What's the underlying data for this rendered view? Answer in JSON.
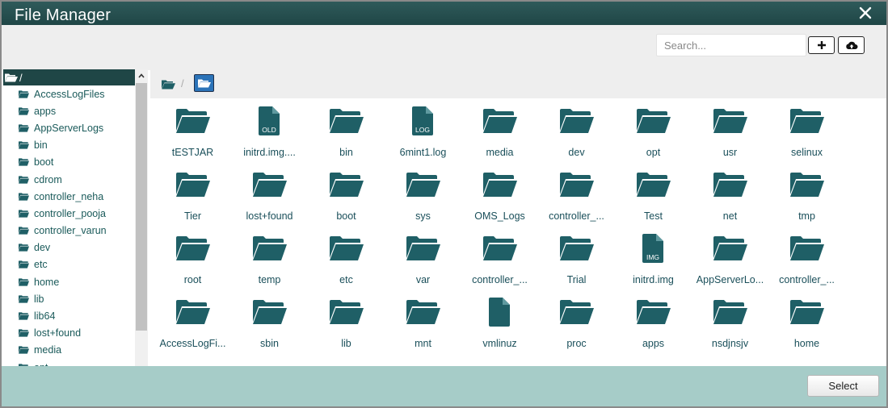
{
  "window": {
    "title": "File Manager",
    "close_icon": "close-icon"
  },
  "toolbar": {
    "search_placeholder": "Search...",
    "search_value": "",
    "add_icon": "plus-icon",
    "upload_icon": "cloud-upload-icon"
  },
  "tree": {
    "root_label": "/",
    "items": [
      "AccessLogFiles",
      "apps",
      "AppServerLogs",
      "bin",
      "boot",
      "cdrom",
      "controller_neha",
      "controller_pooja",
      "controller_varun",
      "dev",
      "etc",
      "home",
      "lib",
      "lib64",
      "lost+found",
      "media",
      "opt"
    ]
  },
  "breadcrumb": {
    "separator": "/",
    "home_icon": "folder-open-icon",
    "current_icon": "folder-open-icon"
  },
  "files": [
    {
      "name": "tESTJAR",
      "type": "folder"
    },
    {
      "name": "initrd.img....",
      "type": "file",
      "badge": "OLD"
    },
    {
      "name": "bin",
      "type": "folder"
    },
    {
      "name": "6mint1.log",
      "type": "file",
      "badge": "LOG"
    },
    {
      "name": "media",
      "type": "folder"
    },
    {
      "name": "dev",
      "type": "folder"
    },
    {
      "name": "opt",
      "type": "folder"
    },
    {
      "name": "usr",
      "type": "folder"
    },
    {
      "name": "selinux",
      "type": "folder"
    },
    {
      "name": "Tier",
      "type": "folder"
    },
    {
      "name": "lost+found",
      "type": "folder"
    },
    {
      "name": "boot",
      "type": "folder"
    },
    {
      "name": "sys",
      "type": "folder"
    },
    {
      "name": "OMS_Logs",
      "type": "folder"
    },
    {
      "name": "controller_...",
      "type": "folder"
    },
    {
      "name": "Test",
      "type": "folder"
    },
    {
      "name": "net",
      "type": "folder"
    },
    {
      "name": "tmp",
      "type": "folder"
    },
    {
      "name": "root",
      "type": "folder"
    },
    {
      "name": "temp",
      "type": "folder"
    },
    {
      "name": "etc",
      "type": "folder"
    },
    {
      "name": "var",
      "type": "folder"
    },
    {
      "name": "controller_...",
      "type": "folder"
    },
    {
      "name": "Trial",
      "type": "folder"
    },
    {
      "name": "initrd.img",
      "type": "file",
      "badge": "IMG"
    },
    {
      "name": "AppServerLo...",
      "type": "folder"
    },
    {
      "name": "controller_...",
      "type": "folder"
    },
    {
      "name": "AccessLogFi...",
      "type": "folder"
    },
    {
      "name": "sbin",
      "type": "folder"
    },
    {
      "name": "lib",
      "type": "folder"
    },
    {
      "name": "mnt",
      "type": "folder"
    },
    {
      "name": "vmlinuz",
      "type": "file",
      "badge": ""
    },
    {
      "name": "proc",
      "type": "folder"
    },
    {
      "name": "apps",
      "type": "folder"
    },
    {
      "name": "nsdjnsjv",
      "type": "folder"
    },
    {
      "name": "home",
      "type": "folder"
    }
  ],
  "footer": {
    "select_label": "Select"
  },
  "colors": {
    "titlebar": "#1f4646",
    "icon": "#1f5f66",
    "footer": "#a6ccc8",
    "text": "#1a5a5a"
  }
}
